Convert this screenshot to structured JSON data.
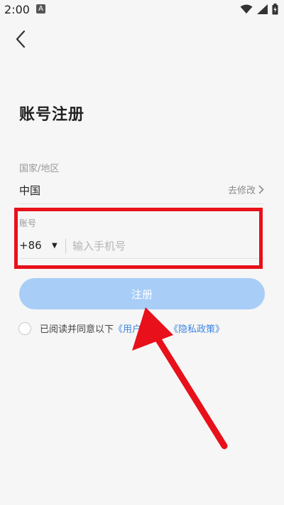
{
  "status_bar": {
    "time": "2:00",
    "notification_glyph": "A"
  },
  "header": {
    "back_icon": "chevron-left-icon"
  },
  "page": {
    "title": "账号注册"
  },
  "region": {
    "label": "国家/地区",
    "value": "中国",
    "edit_label": "去修改"
  },
  "account": {
    "label": "账号",
    "country_code": "+86",
    "phone_placeholder": "输入手机号"
  },
  "register_button": {
    "label": "注册"
  },
  "agreement": {
    "prefix": "已阅读并同意以下",
    "user_agreement": "《用户协",
    "privacy_policy": "《隐私政策》"
  },
  "colors": {
    "accent": "#3c86e0",
    "button_disabled": "#a8cdf7",
    "annotation_red": "#e8101a"
  }
}
